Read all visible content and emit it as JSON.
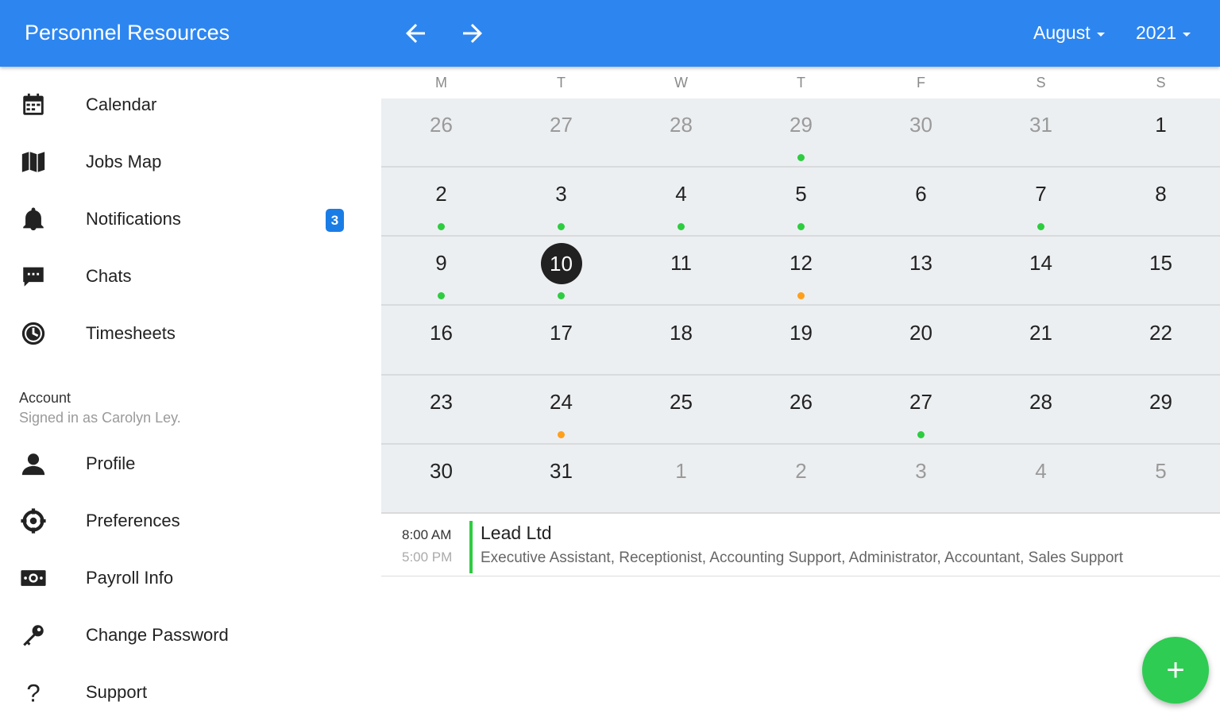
{
  "app": {
    "title": "Personnel Resources"
  },
  "header": {
    "month": "August",
    "year": "2021"
  },
  "sidebar": {
    "items": [
      {
        "label": "Calendar",
        "icon": "calendar-icon"
      },
      {
        "label": "Jobs Map",
        "icon": "map-icon"
      },
      {
        "label": "Notifications",
        "icon": "bell-icon",
        "badge": "3"
      },
      {
        "label": "Chats",
        "icon": "chat-icon"
      },
      {
        "label": "Timesheets",
        "icon": "clock-icon"
      }
    ],
    "account_heading": "Account",
    "account_sub": "Signed in as Carolyn Ley.",
    "account_items": [
      {
        "label": "Profile",
        "icon": "person-icon"
      },
      {
        "label": "Preferences",
        "icon": "settings-icon"
      },
      {
        "label": "Payroll Info",
        "icon": "money-icon"
      },
      {
        "label": "Change Password",
        "icon": "key-icon"
      },
      {
        "label": "Support",
        "icon": "help-icon"
      }
    ]
  },
  "calendar": {
    "weekdays": [
      "M",
      "T",
      "W",
      "T",
      "F",
      "S",
      "S"
    ],
    "weeks": [
      [
        {
          "d": "26",
          "o": true
        },
        {
          "d": "27",
          "o": true
        },
        {
          "d": "28",
          "o": true
        },
        {
          "d": "29",
          "o": true,
          "dot": "green"
        },
        {
          "d": "30",
          "o": true
        },
        {
          "d": "31",
          "o": true
        },
        {
          "d": "1"
        }
      ],
      [
        {
          "d": "2",
          "dot": "green"
        },
        {
          "d": "3",
          "dot": "green"
        },
        {
          "d": "4",
          "dot": "green"
        },
        {
          "d": "5",
          "dot": "green"
        },
        {
          "d": "6"
        },
        {
          "d": "7",
          "dot": "green"
        },
        {
          "d": "8"
        }
      ],
      [
        {
          "d": "9",
          "dot": "green"
        },
        {
          "d": "10",
          "dot": "green",
          "today": true
        },
        {
          "d": "11"
        },
        {
          "d": "12",
          "dot": "orange"
        },
        {
          "d": "13"
        },
        {
          "d": "14"
        },
        {
          "d": "15"
        }
      ],
      [
        {
          "d": "16"
        },
        {
          "d": "17"
        },
        {
          "d": "18"
        },
        {
          "d": "19"
        },
        {
          "d": "20"
        },
        {
          "d": "21"
        },
        {
          "d": "22"
        }
      ],
      [
        {
          "d": "23"
        },
        {
          "d": "24",
          "dot": "orange"
        },
        {
          "d": "25"
        },
        {
          "d": "26"
        },
        {
          "d": "27",
          "dot": "green"
        },
        {
          "d": "28"
        },
        {
          "d": "29"
        }
      ],
      [
        {
          "d": "30"
        },
        {
          "d": "31"
        },
        {
          "d": "1",
          "o": true
        },
        {
          "d": "2",
          "o": true
        },
        {
          "d": "3",
          "o": true
        },
        {
          "d": "4",
          "o": true
        },
        {
          "d": "5",
          "o": true
        }
      ]
    ]
  },
  "event": {
    "start": "8:00 AM",
    "end": "5:00 PM",
    "title": "Lead Ltd",
    "description": "Executive Assistant, Receptionist, Accounting Support, Administrator, Accountant, Sales Support"
  },
  "fab": {
    "label": "+"
  },
  "colors": {
    "primary": "#2d86f0",
    "accent": "#2ecc52",
    "dot_green": "#2ecc40",
    "dot_orange": "#ff9f1c"
  }
}
